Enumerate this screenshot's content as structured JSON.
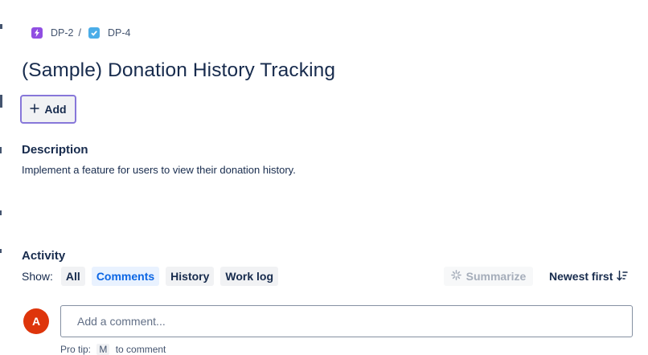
{
  "breadcrumb": {
    "parent_key": "DP-2",
    "separator": "/",
    "issue_key": "DP-4",
    "parent_icon": "epic-lightning-icon",
    "issue_icon": "task-checkbox-icon"
  },
  "issue": {
    "title": "(Sample) Donation History Tracking",
    "add_label": "Add"
  },
  "description": {
    "heading": "Description",
    "text": "Implement a feature for users to view their donation history."
  },
  "activity": {
    "heading": "Activity",
    "show_label": "Show:",
    "filters": [
      "All",
      "Comments",
      "History",
      "Work log"
    ],
    "active_filter": "Comments",
    "summarize_label": "Summarize",
    "sort_label": "Newest first"
  },
  "comment": {
    "avatar_initial": "A",
    "avatar_color": "#de350b",
    "placeholder": "Add a comment...",
    "hint_left": "Pro tip:",
    "hint_key": "M",
    "hint_right": "to comment"
  },
  "colors": {
    "accent": "#0c66e4",
    "add_border": "#8777d9",
    "epic": "#904ee2",
    "task": "#4bade8"
  }
}
